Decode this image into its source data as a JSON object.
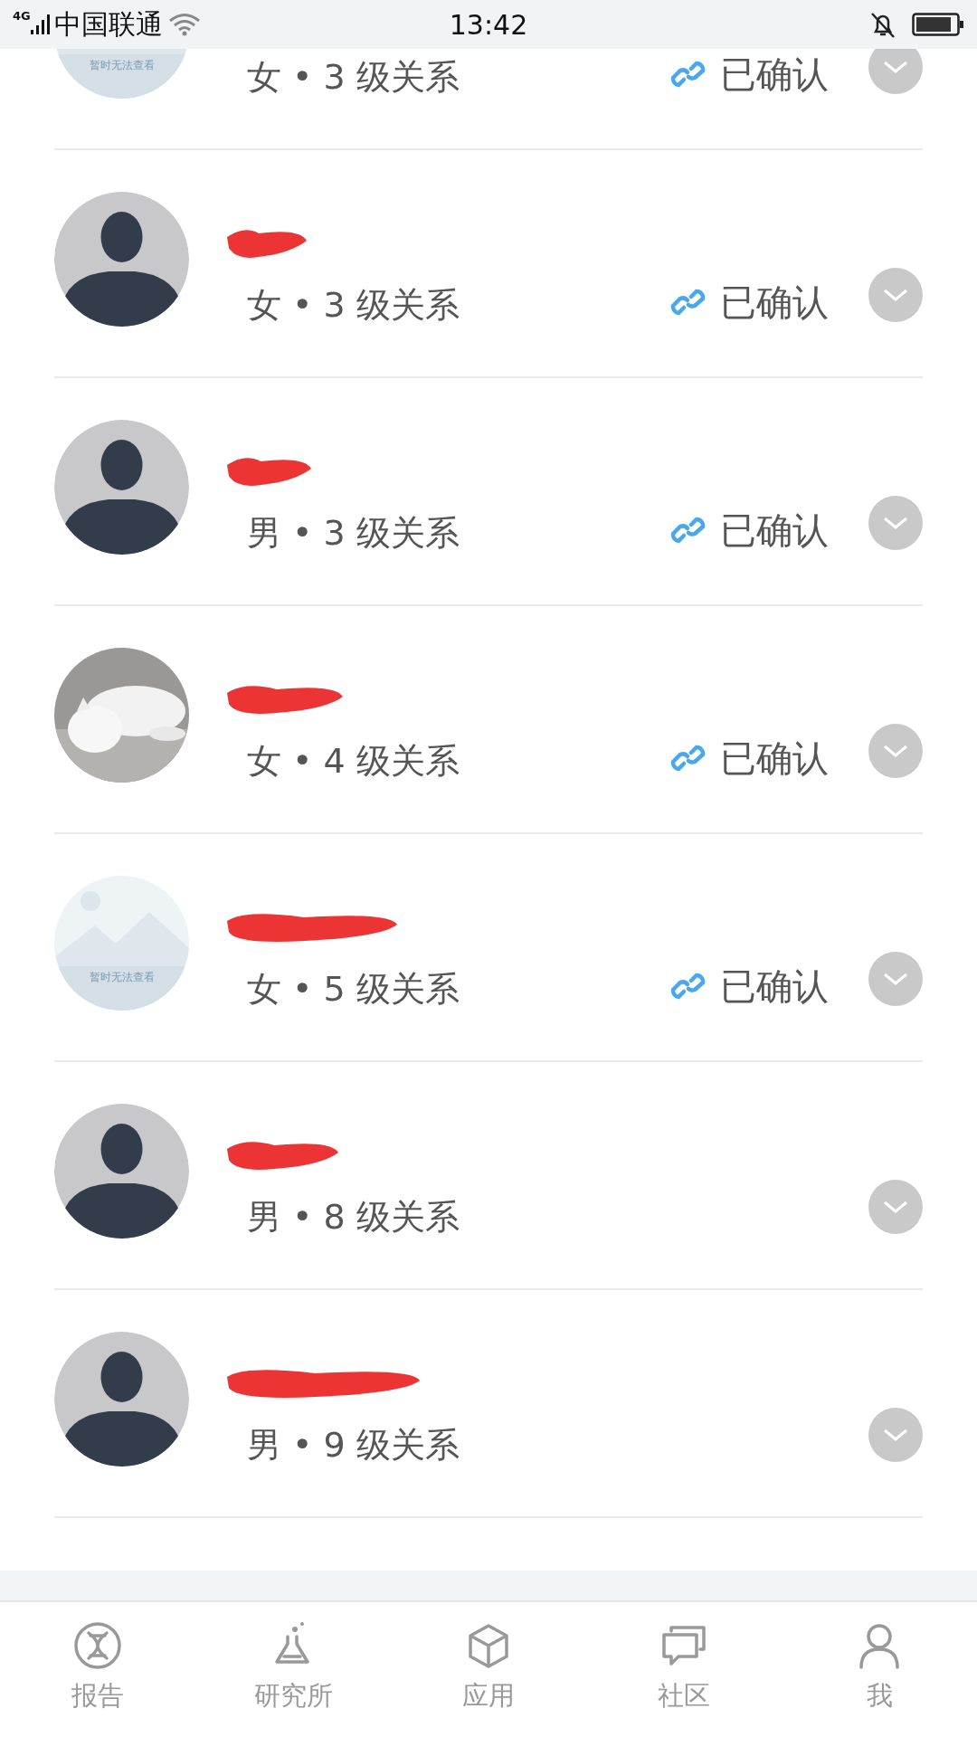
{
  "status_bar": {
    "network": "4G",
    "carrier": "中国联通",
    "time": "13:42"
  },
  "contacts": [
    {
      "avatar": {
        "kind": "unavailable",
        "text": "暂时无法查看"
      },
      "subtitle": "女 • 3 级关系",
      "confirmed": true,
      "status_label": "已确认"
    },
    {
      "avatar": {
        "kind": "silhouette"
      },
      "subtitle": "女 • 3 级关系",
      "confirmed": true,
      "status_label": "已确认"
    },
    {
      "avatar": {
        "kind": "silhouette"
      },
      "subtitle": "男 • 3 级关系",
      "confirmed": true,
      "status_label": "已确认"
    },
    {
      "subtitle": "女 • 4 级关系",
      "confirmed": true,
      "status_label": "已确认"
    },
    {
      "avatar": {
        "kind": "unavailable",
        "text": "暂时无法查看"
      },
      "subtitle": "女 • 5 级关系",
      "confirmed": true,
      "status_label": "已确认"
    },
    {
      "avatar": {
        "kind": "silhouette"
      },
      "subtitle": "男 • 8 级关系",
      "confirmed": false
    },
    {
      "avatar": {
        "kind": "silhouette"
      },
      "subtitle": "男 • 9 级关系",
      "confirmed": false
    }
  ],
  "tab_bar": [
    {
      "label": "报告",
      "selected": false
    },
    {
      "label": "研究所",
      "selected": false
    },
    {
      "label": "应用",
      "selected": false
    },
    {
      "label": "社区",
      "selected": false
    },
    {
      "label": "我",
      "selected": false
    }
  ]
}
